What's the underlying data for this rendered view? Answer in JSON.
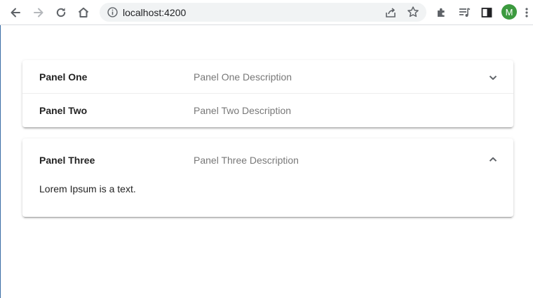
{
  "browser": {
    "url": "localhost:4200",
    "profile_initial": "M",
    "profile_color": "#3c9a3f",
    "icons": [
      "back-icon",
      "forward-icon",
      "reload-icon",
      "home-icon",
      "info-icon",
      "share-icon",
      "star-icon",
      "extensions-icon",
      "media-icon",
      "side-panel-icon",
      "menu-icon"
    ]
  },
  "accordions": [
    {
      "panels": [
        {
          "title": "Panel One",
          "description": "Panel One Description",
          "expanded": false
        },
        {
          "title": "Panel Two",
          "description": "Panel Two Description",
          "expanded": false
        }
      ]
    },
    {
      "panels": [
        {
          "title": "Panel Three",
          "description": "Panel Three Description",
          "expanded": true,
          "content": "Lorem Ipsum is a text."
        }
      ]
    }
  ]
}
